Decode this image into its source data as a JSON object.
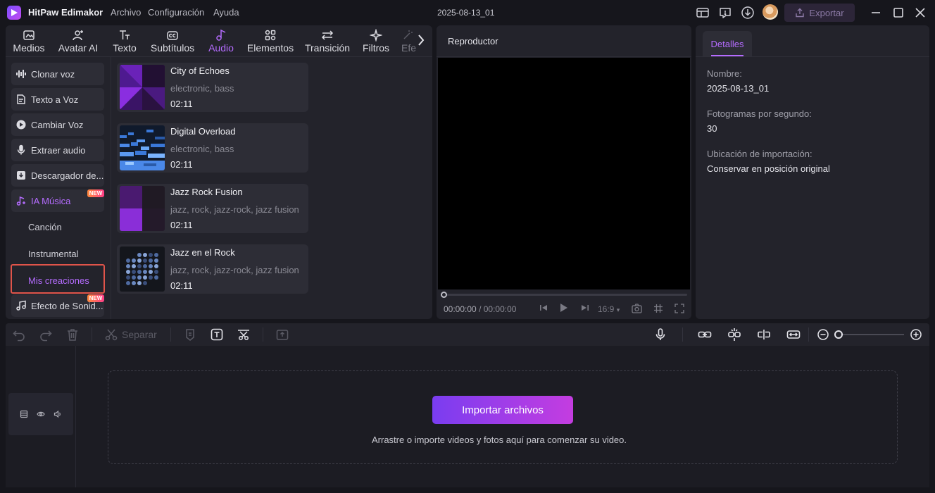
{
  "app": {
    "name": "HitPaw Edimakor",
    "project_title": "2025-08-13_01",
    "export_label": "Exportar"
  },
  "menu": [
    "Archivo",
    "Configuración",
    "Ayuda"
  ],
  "tabs": [
    {
      "label": "Medios",
      "icon": "media-icon"
    },
    {
      "label": "Avatar AI",
      "icon": "avatar-ai-icon"
    },
    {
      "label": "Texto",
      "icon": "text-icon"
    },
    {
      "label": "Subtítulos",
      "icon": "subtitles-icon"
    },
    {
      "label": "Audio",
      "icon": "audio-icon",
      "active": true
    },
    {
      "label": "Elementos",
      "icon": "elements-icon"
    },
    {
      "label": "Transición",
      "icon": "transition-icon"
    },
    {
      "label": "Filtros",
      "icon": "filters-icon"
    },
    {
      "label": "Efe",
      "icon": "effects-icon"
    }
  ],
  "sidebar": {
    "items": [
      {
        "label": "Clonar voz",
        "icon": "voice-clone-icon"
      },
      {
        "label": "Texto a Voz",
        "icon": "text-to-speech-icon"
      },
      {
        "label": "Cambiar Voz",
        "icon": "voice-change-icon"
      },
      {
        "label": "Extraer audio",
        "icon": "microphone-icon"
      },
      {
        "label": "Descargador de...",
        "icon": "download-icon"
      },
      {
        "label": "IA Música",
        "icon": "ai-music-icon",
        "badge": "NEW",
        "active": true
      }
    ],
    "sub_items": [
      {
        "label": "Canción"
      },
      {
        "label": "Instrumental"
      },
      {
        "label": "Mis creaciones",
        "active": true
      }
    ],
    "last_item": {
      "label": "Efecto de Sonid...",
      "icon": "sound-effect-icon",
      "badge": "NEW"
    }
  },
  "tracks": [
    {
      "title": "City of Echoes",
      "tags": "electronic, bass",
      "duration": "02:11"
    },
    {
      "title": "Digital Overload",
      "tags": "electronic, bass",
      "duration": "02:11"
    },
    {
      "title": "Jazz Rock Fusion",
      "tags": "jazz, rock, jazz-rock, jazz fusion",
      "duration": "02:11"
    },
    {
      "title": "Jazz en el Rock",
      "tags": "jazz, rock, jazz-rock, jazz fusion",
      "duration": "02:11"
    }
  ],
  "player": {
    "header": "Reproductor",
    "current_time": "00:00:00",
    "total_time": "/ 00:00:00",
    "aspect": "16:9",
    "progress": 0
  },
  "details": {
    "tab": "Detalles",
    "fields": [
      {
        "label": "Nombre:",
        "value": "2025-08-13_01"
      },
      {
        "label": "Fotogramas por segundo:",
        "value": "30"
      },
      {
        "label": "Ubicación de importación:",
        "value": "Conservar en posición original"
      }
    ]
  },
  "timeline": {
    "split_label": "Separar",
    "import_button": "Importar archivos",
    "drop_hint": "Arrastre o importe videos y fotos aquí para comenzar su video."
  },
  "colors": {
    "accent": "#b56cff",
    "highlight_border": "#e0544a",
    "import_gradient_start": "#7a3df0",
    "import_gradient_end": "#c43de0"
  }
}
